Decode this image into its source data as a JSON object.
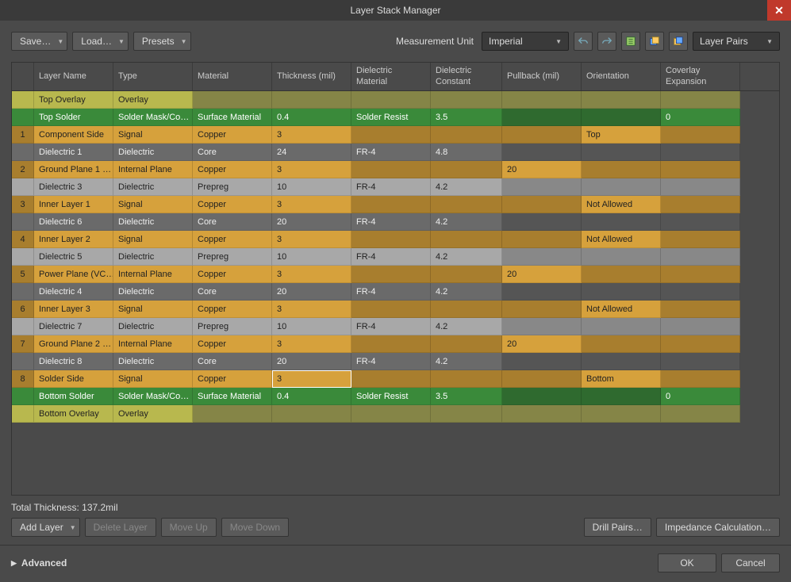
{
  "window": {
    "title": "Layer Stack Manager"
  },
  "toolbar": {
    "save": "Save…",
    "load": "Load…",
    "presets": "Presets",
    "measurement_label": "Measurement Unit",
    "measurement_value": "Imperial",
    "layer_pairs": "Layer Pairs"
  },
  "columns": {
    "idx": "",
    "name": "Layer Name",
    "type": "Type",
    "material": "Material",
    "thickness": "Thickness (mil)",
    "dmat": "Dielectric Material",
    "dconst": "Dielectric Constant",
    "pullback": "Pullback (mil)",
    "orientation": "Orientation",
    "coverlay": "Coverlay Expansion"
  },
  "rows": [
    {
      "cls": "overlay",
      "idx": "",
      "name": "Top Overlay",
      "type": "Overlay",
      "mat": "",
      "thk": "",
      "dmat": "",
      "dcon": "",
      "pull": "",
      "ori": "",
      "cov": ""
    },
    {
      "cls": "solder",
      "idx": "",
      "name": "Top Solder",
      "type": "Solder Mask/Co…",
      "mat": "Surface Material",
      "thk": "0.4",
      "dmat": "Solder Resist",
      "dcon": "3.5",
      "pull": "",
      "ori": "",
      "cov": "0"
    },
    {
      "cls": "signal",
      "idx": "1",
      "name": "Component Side",
      "type": "Signal",
      "mat": "Copper",
      "thk": "3",
      "dmat": "",
      "dcon": "",
      "pull": "",
      "ori": "Top",
      "cov": ""
    },
    {
      "cls": "die-core",
      "idx": "",
      "name": "Dielectric 1",
      "type": "Dielectric",
      "mat": "Core",
      "thk": "24",
      "dmat": "FR-4",
      "dcon": "4.8",
      "pull": "",
      "ori": "",
      "cov": ""
    },
    {
      "cls": "plane",
      "idx": "2",
      "name": "Ground Plane 1 …",
      "type": "Internal Plane",
      "mat": "Copper",
      "thk": "3",
      "dmat": "",
      "dcon": "",
      "pull": "20",
      "ori": "",
      "cov": ""
    },
    {
      "cls": "die-prepreg",
      "idx": "",
      "name": "Dielectric 3",
      "type": "Dielectric",
      "mat": "Prepreg",
      "thk": "10",
      "dmat": "FR-4",
      "dcon": "4.2",
      "pull": "",
      "ori": "",
      "cov": ""
    },
    {
      "cls": "signal",
      "idx": "3",
      "name": "Inner Layer 1",
      "type": "Signal",
      "mat": "Copper",
      "thk": "3",
      "dmat": "",
      "dcon": "",
      "pull": "",
      "ori": "Not Allowed",
      "cov": ""
    },
    {
      "cls": "die-core",
      "idx": "",
      "name": "Dielectric 6",
      "type": "Dielectric",
      "mat": "Core",
      "thk": "20",
      "dmat": "FR-4",
      "dcon": "4.2",
      "pull": "",
      "ori": "",
      "cov": ""
    },
    {
      "cls": "signal",
      "idx": "4",
      "name": "Inner Layer 2",
      "type": "Signal",
      "mat": "Copper",
      "thk": "3",
      "dmat": "",
      "dcon": "",
      "pull": "",
      "ori": "Not Allowed",
      "cov": ""
    },
    {
      "cls": "die-prepreg",
      "idx": "",
      "name": "Dielectric 5",
      "type": "Dielectric",
      "mat": "Prepreg",
      "thk": "10",
      "dmat": "FR-4",
      "dcon": "4.2",
      "pull": "",
      "ori": "",
      "cov": ""
    },
    {
      "cls": "plane",
      "idx": "5",
      "name": "Power Plane (VC…",
      "type": "Internal Plane",
      "mat": "Copper",
      "thk": "3",
      "dmat": "",
      "dcon": "",
      "pull": "20",
      "ori": "",
      "cov": ""
    },
    {
      "cls": "die-core",
      "idx": "",
      "name": "Dielectric 4",
      "type": "Dielectric",
      "mat": "Core",
      "thk": "20",
      "dmat": "FR-4",
      "dcon": "4.2",
      "pull": "",
      "ori": "",
      "cov": ""
    },
    {
      "cls": "signal",
      "idx": "6",
      "name": "Inner Layer 3",
      "type": "Signal",
      "mat": "Copper",
      "thk": "3",
      "dmat": "",
      "dcon": "",
      "pull": "",
      "ori": "Not Allowed",
      "cov": ""
    },
    {
      "cls": "die-prepreg",
      "idx": "",
      "name": "Dielectric 7",
      "type": "Dielectric",
      "mat": "Prepreg",
      "thk": "10",
      "dmat": "FR-4",
      "dcon": "4.2",
      "pull": "",
      "ori": "",
      "cov": ""
    },
    {
      "cls": "plane",
      "idx": "7",
      "name": "Ground Plane 2 …",
      "type": "Internal Plane",
      "mat": "Copper",
      "thk": "3",
      "dmat": "",
      "dcon": "",
      "pull": "20",
      "ori": "",
      "cov": ""
    },
    {
      "cls": "die-core",
      "idx": "",
      "name": "Dielectric 8",
      "type": "Dielectric",
      "mat": "Core",
      "thk": "20",
      "dmat": "FR-4",
      "dcon": "4.2",
      "pull": "",
      "ori": "",
      "cov": ""
    },
    {
      "cls": "signal",
      "idx": "8",
      "name": "Solder Side",
      "type": "Signal",
      "mat": "Copper",
      "thk": "3",
      "dmat": "",
      "dcon": "",
      "pull": "",
      "ori": "Bottom",
      "cov": "",
      "hl": true
    },
    {
      "cls": "solder",
      "idx": "",
      "name": "Bottom Solder",
      "type": "Solder Mask/Co…",
      "mat": "Surface Material",
      "thk": "0.4",
      "dmat": "Solder Resist",
      "dcon": "3.5",
      "pull": "",
      "ori": "",
      "cov": "0"
    },
    {
      "cls": "overlay",
      "idx": "",
      "name": "Bottom Overlay",
      "type": "Overlay",
      "mat": "",
      "thk": "",
      "dmat": "",
      "dcon": "",
      "pull": "",
      "ori": "",
      "cov": ""
    }
  ],
  "summary": {
    "total_thickness": "Total Thickness: 137.2mil"
  },
  "buttons": {
    "add_layer": "Add Layer",
    "delete_layer": "Delete Layer",
    "move_up": "Move Up",
    "move_down": "Move Down",
    "drill_pairs": "Drill Pairs…",
    "impedance": "Impedance Calculation…",
    "ok": "OK",
    "cancel": "Cancel",
    "advanced": "Advanced"
  }
}
